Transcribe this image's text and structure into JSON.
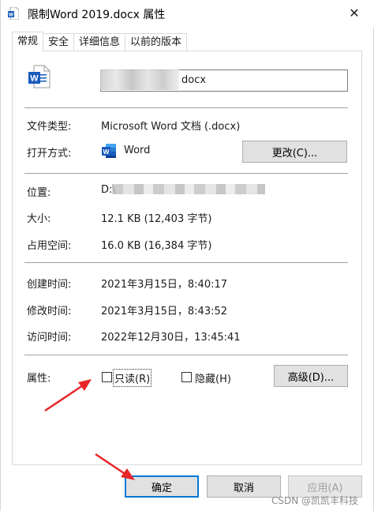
{
  "window": {
    "title": "限制Word 2019.docx 属性",
    "close_glyph": "✕"
  },
  "tabs": [
    {
      "label": "常规",
      "active": true
    },
    {
      "label": "安全",
      "active": false
    },
    {
      "label": "详细信息",
      "active": false
    },
    {
      "label": "以前的版本",
      "active": false
    }
  ],
  "file": {
    "name_visible_suffix": "docx",
    "icon": "word-document-icon",
    "icon_letter": "W"
  },
  "general": {
    "type_label": "文件类型:",
    "type_value": "Microsoft Word 文档 (.docx)",
    "open_with_label": "打开方式:",
    "open_with_value": "Word",
    "change_button": "更改(C)...",
    "location_label": "位置:",
    "location_value_prefix": "D:\\",
    "size_label": "大小:",
    "size_value": "12.1 KB (12,403 字节)",
    "disk_label": "占用空间:",
    "disk_value": "16.0 KB (16,384 字节)",
    "created_label": "创建时间:",
    "created_value": "2021年3月15日，8:40:17",
    "modified_label": "修改时间:",
    "modified_value": "2021年3月15日，8:43:52",
    "accessed_label": "访问时间:",
    "accessed_value": "2022年12月30日，13:45:41",
    "attributes_label": "属性:",
    "readonly_label": "只读(R)",
    "readonly_checked": false,
    "hidden_label": "隐藏(H)",
    "hidden_checked": false,
    "advanced_button": "高级(D)..."
  },
  "footer": {
    "ok": "确定",
    "cancel": "取消",
    "apply": "应用(A)"
  },
  "watermark": "CSDN @凯凯丰科技",
  "colors": {
    "word_blue": "#185abd",
    "focus_blue": "#0078d7",
    "arrow_red": "#e8262a"
  }
}
